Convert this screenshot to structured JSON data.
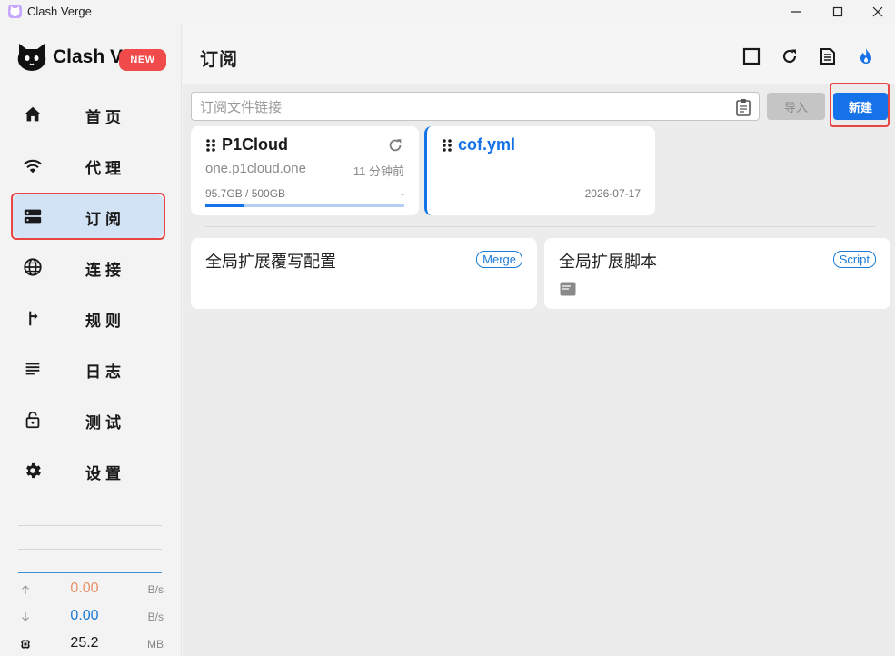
{
  "window": {
    "title": "Clash Verge",
    "controls": {
      "minimize": "minimize",
      "maximize": "maximize",
      "close": "close"
    }
  },
  "sidebar": {
    "logo_text": "Clash Verge",
    "new_badge": "NEW",
    "items": [
      {
        "label": "首页",
        "icon": "home-icon",
        "active": false
      },
      {
        "label": "代理",
        "icon": "wifi-icon",
        "active": false
      },
      {
        "label": "订阅",
        "icon": "storage-icon",
        "active": true
      },
      {
        "label": "连接",
        "icon": "globe-icon",
        "active": false
      },
      {
        "label": "规则",
        "icon": "fork-arrow-icon",
        "active": false
      },
      {
        "label": "日志",
        "icon": "list-icon",
        "active": false
      },
      {
        "label": "测试",
        "icon": "lock-open-icon",
        "active": false
      },
      {
        "label": "设置",
        "icon": "gear-icon",
        "active": false
      }
    ],
    "traffic": {
      "upload": {
        "value": "0.00",
        "unit": "B/s",
        "color": "#e8916a"
      },
      "download": {
        "value": "0.00",
        "unit": "B/s",
        "color": "#1a7ad6"
      },
      "memory": {
        "value": "25.2",
        "unit": "MB"
      }
    }
  },
  "header": {
    "title": "订阅",
    "actions": [
      "stop-square-icon",
      "refresh-icon",
      "document-icon",
      "flame-icon"
    ]
  },
  "import_bar": {
    "placeholder": "订阅文件链接",
    "value": "",
    "import_label": "导入",
    "new_label": "新建"
  },
  "profiles": [
    {
      "name": "P1Cloud",
      "host": "one.p1cloud.one",
      "updated": "11 分钟前",
      "usage": "95.7GB / 500GB",
      "usage_fraction": 0.191,
      "expire": "-",
      "selected": false
    },
    {
      "name": "cof.yml",
      "date": "2026-07-17",
      "selected": true
    }
  ],
  "extensions": [
    {
      "title": "全局扩展覆写配置",
      "badge": "Merge"
    },
    {
      "title": "全局扩展脚本",
      "badge": "Script"
    }
  ],
  "colors": {
    "accent": "#1572e8",
    "highlight": "#e84545",
    "active_nav_bg": "#d3e3f6"
  }
}
